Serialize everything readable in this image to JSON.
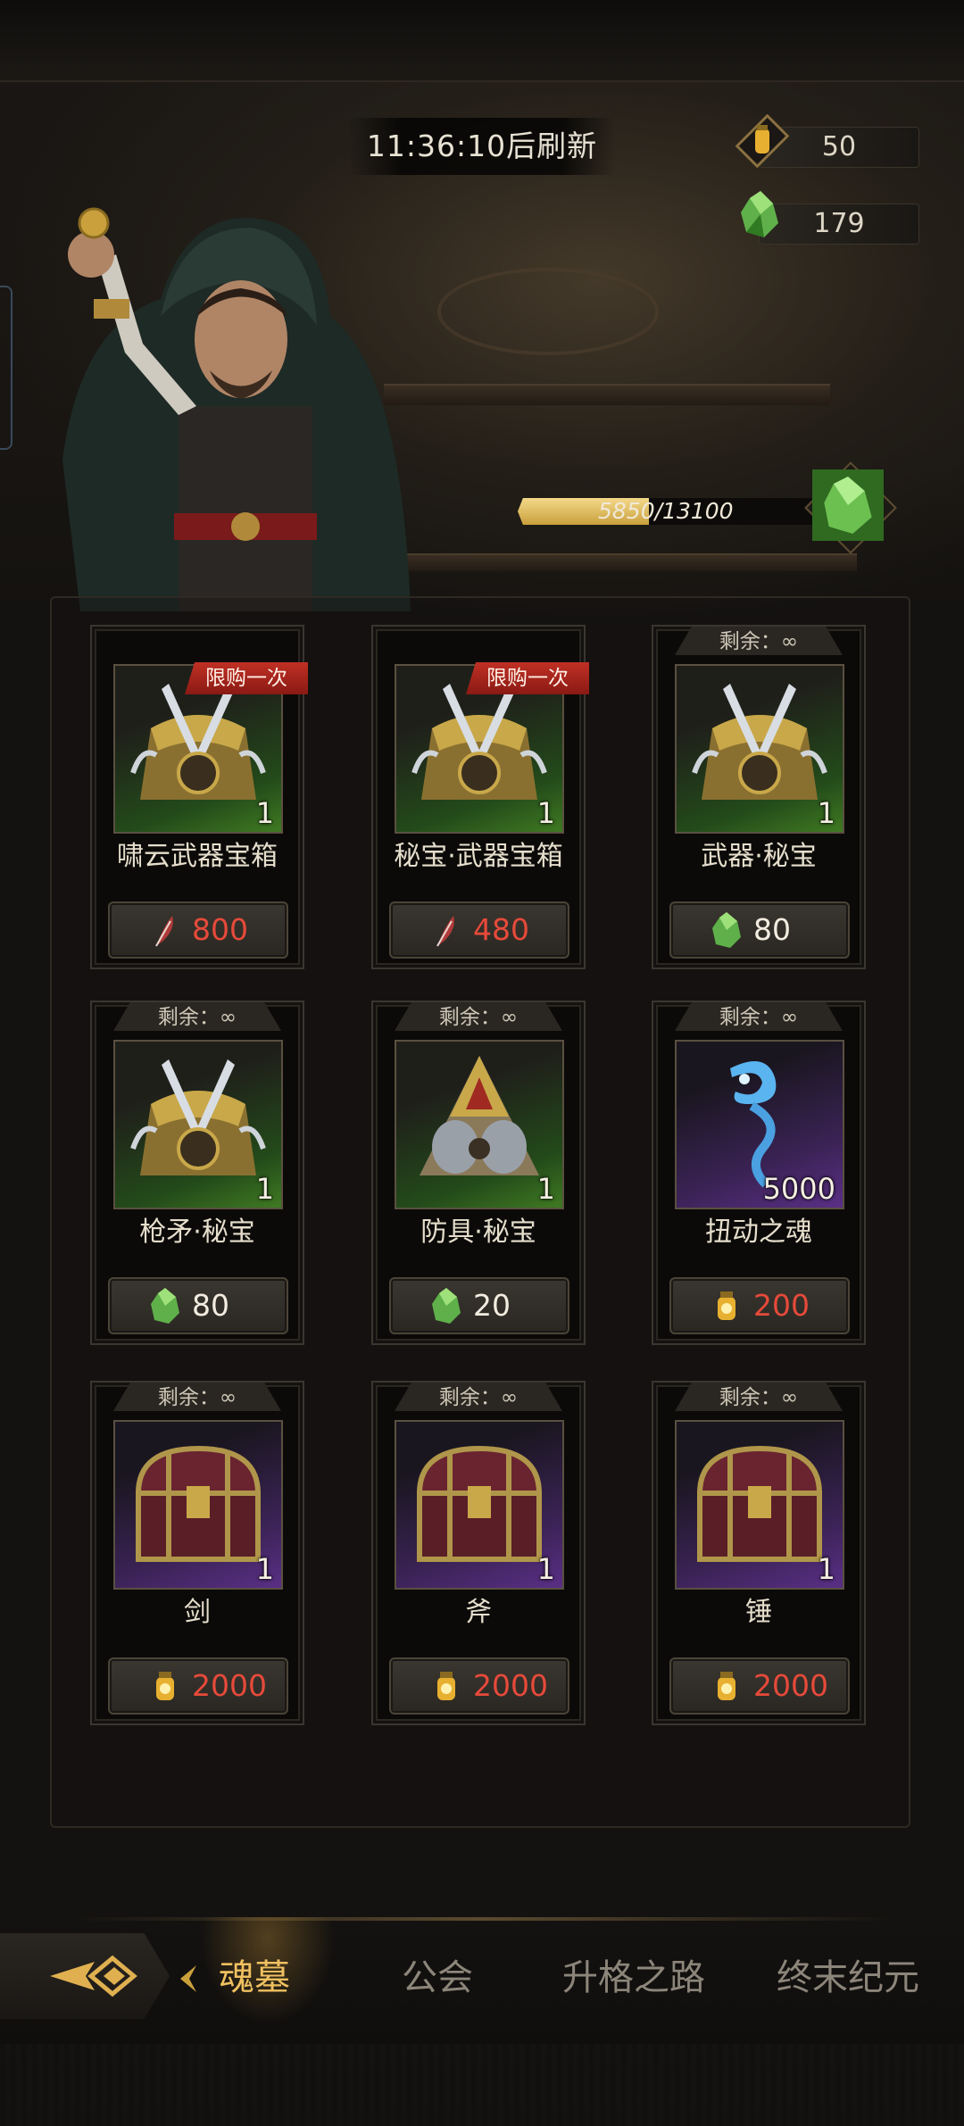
{
  "header": {
    "refresh_timer": "11:36:10后刷新",
    "currencies": [
      {
        "icon": "lantern-icon",
        "value": "50"
      },
      {
        "icon": "green-crystal-icon",
        "value": "179"
      }
    ]
  },
  "progress": {
    "current": "5850",
    "max": "/13100",
    "fraction": 0.4466,
    "reward_icon": "green-crystal-icon"
  },
  "shop": {
    "items": [
      {
        "name": "啸云武器宝箱",
        "stock": "",
        "badge": "限购一次",
        "qty": "1",
        "icon": "weapon-chest-icon",
        "rarity": "green",
        "price": "800",
        "price_icon": "red-feather-icon",
        "price_red": true
      },
      {
        "name": "秘宝·武器宝箱",
        "stock": "",
        "badge": "限购一次",
        "qty": "1",
        "icon": "weapon-chest-icon",
        "rarity": "green",
        "price": "480",
        "price_icon": "red-feather-icon",
        "price_red": true
      },
      {
        "name": "武器·秘宝",
        "stock": "剩余：∞",
        "badge": "",
        "qty": "1",
        "icon": "weapon-chest-icon",
        "rarity": "green",
        "price": "80",
        "price_icon": "green-crystal-icon",
        "price_red": false
      },
      {
        "name": "枪矛·秘宝",
        "stock": "剩余：∞",
        "badge": "",
        "qty": "1",
        "icon": "weapon-chest-icon",
        "rarity": "green",
        "price": "80",
        "price_icon": "green-crystal-icon",
        "price_red": false
      },
      {
        "name": "防具·秘宝",
        "stock": "剩余：∞",
        "badge": "",
        "qty": "1",
        "icon": "armor-chest-icon",
        "rarity": "green",
        "price": "20",
        "price_icon": "green-crystal-icon",
        "price_red": false
      },
      {
        "name": "扭动之魂",
        "stock": "剩余：∞",
        "badge": "",
        "qty": "5000",
        "icon": "twisting-soul-icon",
        "rarity": "purple",
        "price": "200",
        "price_icon": "lantern-icon",
        "price_red": true
      },
      {
        "name": "剑",
        "stock": "剩余：∞",
        "badge": "",
        "qty": "1",
        "icon": "treasure-chest-icon",
        "rarity": "purple",
        "price": "2000",
        "price_icon": "lantern-icon",
        "price_red": true
      },
      {
        "name": "斧",
        "stock": "剩余：∞",
        "badge": "",
        "qty": "1",
        "icon": "treasure-chest-icon",
        "rarity": "purple",
        "price": "2000",
        "price_icon": "lantern-icon",
        "price_red": true
      },
      {
        "name": "锤",
        "stock": "剩余：∞",
        "badge": "",
        "qty": "1",
        "icon": "treasure-chest-icon",
        "rarity": "purple",
        "price": "2000",
        "price_icon": "lantern-icon",
        "price_red": true
      }
    ]
  },
  "nav": {
    "back_icon": "back-arrow-icon",
    "tabs": [
      {
        "label": "魂墓",
        "active": true
      },
      {
        "label": "公会",
        "active": false
      },
      {
        "label": "升格之路",
        "active": false
      },
      {
        "label": "终末纪元",
        "active": false
      }
    ]
  },
  "colors": {
    "price_red": "#e64a3a",
    "active_tab": "#f0c060",
    "limit_badge": "#c03024"
  }
}
